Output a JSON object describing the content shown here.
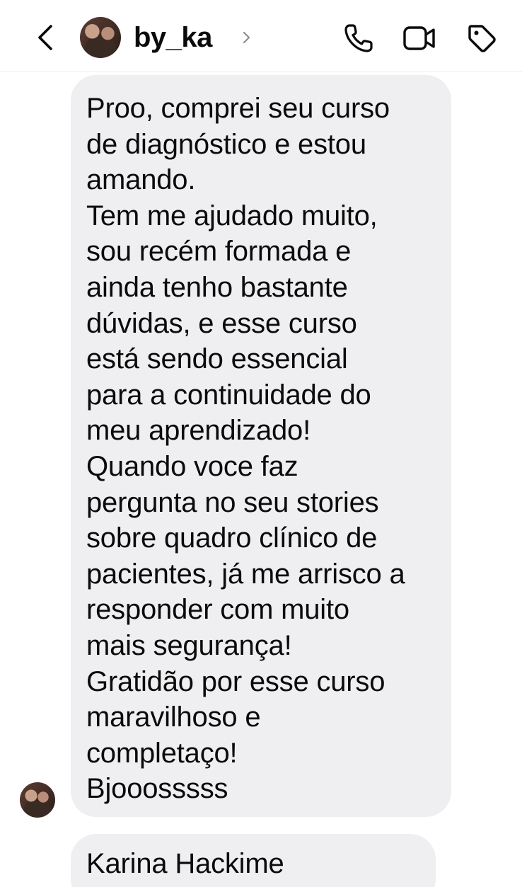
{
  "header": {
    "contact_name": "by_ka",
    "icons": {
      "back": "chevron-left-icon",
      "chevron": "chevron-right-icon",
      "call": "phone-icon",
      "video": "video-camera-icon",
      "tag": "tag-icon"
    }
  },
  "messages": [
    {
      "lines": [
        "Proo, comprei seu curso",
        "de diagnóstico e estou",
        "amando.",
        "Tem me ajudado muito,",
        "sou recém formada e",
        "ainda tenho bastante",
        "dúvidas, e esse curso",
        "está sendo essencial",
        "para a continuidade do",
        "meu aprendizado!",
        "Quando voce faz",
        "pergunta no seu stories",
        "sobre quadro clínico de",
        "pacientes, já me arrisco a",
        "responder com muito",
        "mais segurança!",
        "Gratidão por esse curso",
        "maravilhoso e",
        "completaço!",
        "Bjooosssss"
      ]
    },
    {
      "lines": [
        "Karina Hackime"
      ]
    }
  ],
  "colors": {
    "bubble_bg": "#efeff1",
    "text": "#0b0b0b",
    "chevron_gray": "#8e8e93"
  }
}
